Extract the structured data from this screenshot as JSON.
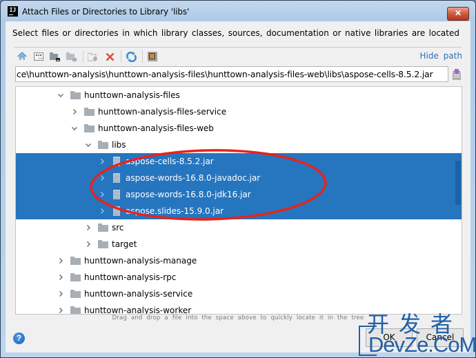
{
  "window": {
    "title": "Attach Files or Directories to Library 'libs'",
    "close_label": "✕",
    "app_icon_label": "IJ"
  },
  "description": "Select files or directories in which library classes, sources, documentation or native libraries are located",
  "toolbar": {
    "buttons": [
      {
        "name": "home-icon"
      },
      {
        "name": "desktop-icon"
      },
      {
        "name": "project-icon"
      },
      {
        "name": "module-icon"
      },
      {
        "name": "new-folder-icon"
      },
      {
        "name": "delete-icon"
      },
      {
        "name": "refresh-icon"
      },
      {
        "name": "show-hidden-icon"
      }
    ],
    "hide_path_label": "Hide path"
  },
  "path": {
    "value": "ce\\hunttown-analysis\\hunttown-analysis-files\\hunttown-analysis-files-web\\libs\\aspose-cells-8.5.2.jar"
  },
  "tree": {
    "rows": [
      {
        "label": "hunttown-analysis-files",
        "type": "folder",
        "depth": 1,
        "expanded": true,
        "selected": false
      },
      {
        "label": "hunttown-analysis-files-service",
        "type": "folder",
        "depth": 2,
        "expanded": false,
        "selected": false
      },
      {
        "label": "hunttown-analysis-files-web",
        "type": "folder",
        "depth": 2,
        "expanded": true,
        "selected": false
      },
      {
        "label": "libs",
        "type": "folder",
        "depth": 3,
        "expanded": true,
        "selected": false
      },
      {
        "label": "aspose-cells-8.5.2.jar",
        "type": "jar",
        "depth": 4,
        "expanded": false,
        "selected": true
      },
      {
        "label": "aspose-words-16.8.0-javadoc.jar",
        "type": "jar",
        "depth": 4,
        "expanded": false,
        "selected": true
      },
      {
        "label": "aspose-words-16.8.0-jdk16.jar",
        "type": "jar",
        "depth": 4,
        "expanded": false,
        "selected": true
      },
      {
        "label": "aspose.slides-15.9.0.jar",
        "type": "jar",
        "depth": 4,
        "expanded": false,
        "selected": true
      },
      {
        "label": "src",
        "type": "folder",
        "depth": 3,
        "expanded": false,
        "selected": false
      },
      {
        "label": "target",
        "type": "folder",
        "depth": 3,
        "expanded": false,
        "selected": false
      },
      {
        "label": "hunttown-analysis-manage",
        "type": "folder",
        "depth": 1,
        "expanded": false,
        "selected": false
      },
      {
        "label": "hunttown-analysis-rpc",
        "type": "folder",
        "depth": 1,
        "expanded": false,
        "selected": false
      },
      {
        "label": "hunttown-analysis-service",
        "type": "folder",
        "depth": 1,
        "expanded": false,
        "selected": false
      },
      {
        "label": "hunttown-analysis-worker",
        "type": "folder",
        "depth": 1,
        "expanded": false,
        "selected": false
      }
    ]
  },
  "drop_hint": "Drag and drop a file into the space above to quickly locate it in the tree",
  "buttons": {
    "help": "?",
    "ok": "OK",
    "cancel": "Cancel"
  },
  "watermark": {
    "cn": "开发者",
    "en": "DevZe.CoM"
  },
  "colors": {
    "selection": "#2675bf",
    "annotation": "#e8231b",
    "link": "#2a6ebd"
  }
}
